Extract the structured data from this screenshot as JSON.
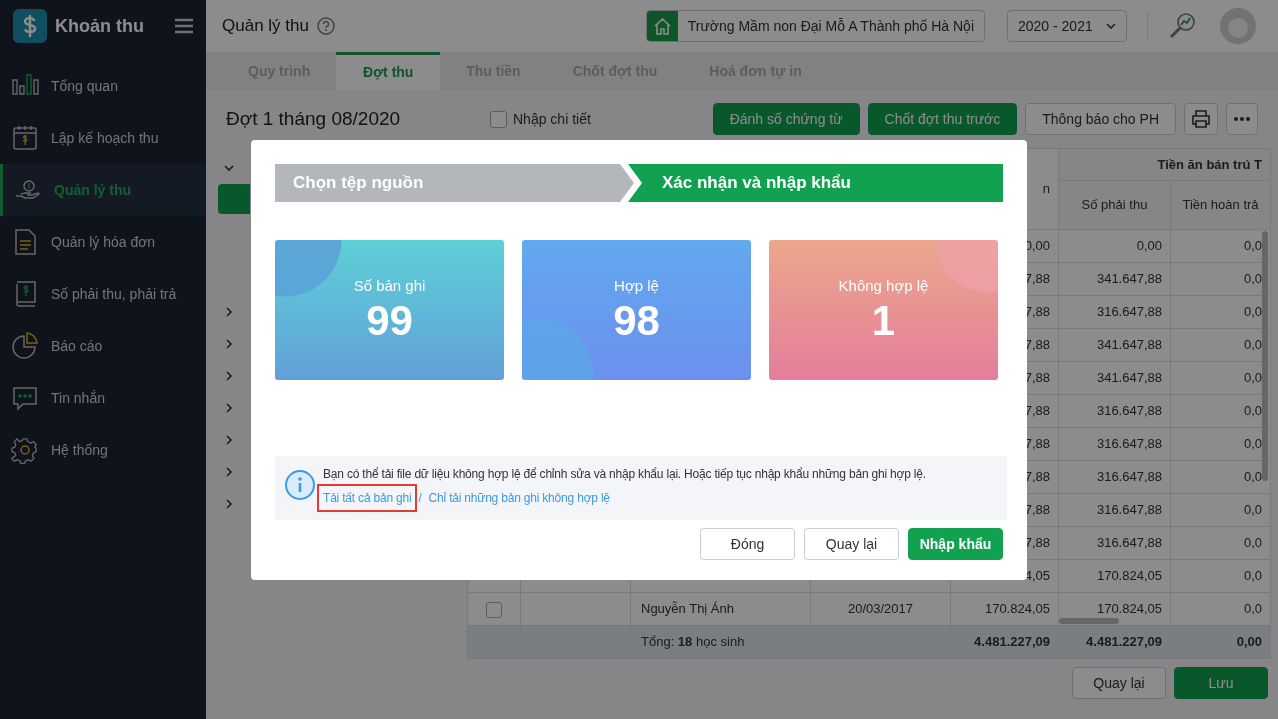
{
  "sidebar": {
    "app_title": "Khoản thu",
    "items": [
      {
        "label": "Tổng quan",
        "selected": false
      },
      {
        "label": "Lập kế hoạch thu",
        "selected": false
      },
      {
        "label": "Quản lý thu",
        "selected": true
      },
      {
        "label": "Quản lý hóa đơn",
        "selected": false
      },
      {
        "label": "Số phải thu, phải trả",
        "selected": false
      },
      {
        "label": "Báo cáo",
        "selected": false
      },
      {
        "label": "Tin nhắn",
        "selected": false
      },
      {
        "label": "Hệ thống",
        "selected": false
      }
    ]
  },
  "header": {
    "title": "Quản lý thu",
    "school": "Trường Mầm non Đại Mỗ A Thành phố Hà Nội",
    "year": "2020 - 2021"
  },
  "tabs": [
    {
      "label": "Quy trình",
      "selected": false
    },
    {
      "label": "Đợt thu",
      "selected": true
    },
    {
      "label": "Thu tiền",
      "selected": false
    },
    {
      "label": "Chốt đợt thu",
      "selected": false
    },
    {
      "label": "Hoá đơn tự in",
      "selected": false
    }
  ],
  "toolbar": {
    "title": "Đợt 1 tháng 08/2020",
    "detail_checkbox": {
      "label": "Nhập chi tiết",
      "checked": false
    },
    "buttons": [
      {
        "label": "Đánh số chứng từ",
        "kind": "primary"
      },
      {
        "label": "Chốt đợt thu trước",
        "kind": "primary"
      },
      {
        "label": "Thông báo cho PH",
        "kind": "secondary"
      }
    ]
  },
  "left_panel": {
    "expanders": [
      {
        "expanded": true
      },
      {
        "expanded": false
      },
      {
        "expanded": false
      },
      {
        "expanded": false
      },
      {
        "expanded": false
      },
      {
        "expanded": false
      },
      {
        "expanded": false
      },
      {
        "expanded": false
      }
    ]
  },
  "table": {
    "partial_header": "n",
    "group_header": "Tiền ăn bán trú T",
    "columns": [
      "Số phải thu",
      "Tiền hoàn trả"
    ],
    "rows": [
      {
        "amount": "0,00",
        "due": "0,00",
        "refund": "0,0"
      },
      {
        "amount": "7,88",
        "due": "341.647,88",
        "refund": "0,0"
      },
      {
        "amount": "7,88",
        "due": "316.647,88",
        "refund": "0,0"
      },
      {
        "amount": "7,88",
        "due": "341.647,88",
        "refund": "0,0"
      },
      {
        "amount": "7,88",
        "due": "341.647,88",
        "refund": "0,0"
      },
      {
        "amount": "7,88",
        "due": "316.647,88",
        "refund": "0,0"
      },
      {
        "amount": "7,88",
        "due": "316.647,88",
        "refund": "0,0"
      },
      {
        "amount": "7,88",
        "due": "316.647,88",
        "refund": "0,0"
      },
      {
        "amount": "7,88",
        "due": "316.647,88",
        "refund": "0,0"
      },
      {
        "amount": "7,88",
        "due": "316.647,88",
        "refund": "0,0"
      },
      {
        "amount": "4,05",
        "due": "170.824,05",
        "refund": "0,0"
      },
      {
        "checked": false,
        "name": "Nguyễn Thị Ánh",
        "date": "20/03/2017",
        "amount": "170.824,05",
        "due": "170.824,05",
        "refund": "0,0"
      }
    ],
    "total": {
      "label": "Tổng: **18** học sinh",
      "amount": "4.481.227,09",
      "due": "4.481.227,09",
      "refund": "0,00"
    }
  },
  "footer_buttons": [
    {
      "label": "Quay lại",
      "kind": "secondary"
    },
    {
      "label": "Lưu",
      "kind": "primary"
    }
  ],
  "dialog": {
    "steps": [
      {
        "label": "Chọn tệp nguồn",
        "selected": false
      },
      {
        "label": "Xác nhận và nhập khẩu",
        "selected": true
      }
    ],
    "cards": [
      {
        "kind": "total",
        "label": "Số bản ghi",
        "value": "99"
      },
      {
        "kind": "valid",
        "label": "Hợp lệ",
        "value": "98"
      },
      {
        "kind": "invalid",
        "label": "Không hợp lệ",
        "value": "1"
      }
    ],
    "info": {
      "message": "Bạn có thể tải file dữ liệu không hợp lệ để chỉnh sửa và nhập khẩu lại. Hoặc tiếp tục nhập khẩu những bản ghi hợp lệ.",
      "links": [
        {
          "label": "Tải tất cả bản ghi",
          "highlighted": true
        },
        {
          "label": "Chỉ tải những bản ghi không hợp lệ",
          "highlighted": false
        }
      ],
      "separator": "/"
    },
    "buttons": [
      {
        "label": "Đóng",
        "kind": "secondary"
      },
      {
        "label": "Quay lại",
        "kind": "secondary"
      },
      {
        "label": "Nhập khẩu",
        "kind": "primary"
      }
    ]
  }
}
